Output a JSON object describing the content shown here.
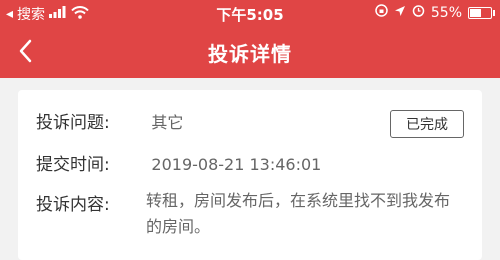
{
  "status_bar": {
    "carrier": "搜索",
    "time": "下午5:05",
    "battery_text": "55%",
    "battery_level": 0.55
  },
  "nav": {
    "title": "投诉详情"
  },
  "complaint": {
    "issue_label": "投诉问题:",
    "issue_value": "其它",
    "status": "已完成",
    "time_label": "提交时间:",
    "time_value": "2019-08-21 13:46:01",
    "content_label": "投诉内容:",
    "content_value": "转租，房间发布后，在系统里找不到我发布的房间。"
  },
  "colors": {
    "header": "#e04545"
  }
}
